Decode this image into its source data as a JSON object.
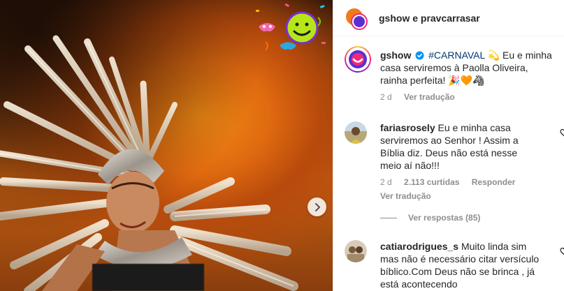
{
  "media": {
    "next_icon": "chevron-right-icon",
    "sticker_icon": "smiley-carnival-sticker"
  },
  "header": {
    "title": "gshow e pravcarrasar",
    "avatar_icon": "gshow-avatar"
  },
  "caption": {
    "username": "gshow",
    "verified_icon": "verified-badge-icon",
    "hashtag": "#CARNAVAL",
    "emoji_1": "💫",
    "text": "Eu e minha casa serviremos à Paolla Oliveira, rainha perfeita!",
    "emoji_2": "🎉🧡🦓",
    "time": "2 d",
    "translate": "Ver tradução"
  },
  "comments": [
    {
      "username": "fariasrosely",
      "text": "Eu e minha casa serviremos ao Senhor ! Assim a Bíblia diz. Deus não está nesse meio aí não!!!",
      "time": "2 d",
      "likes": "2.113 curtidas",
      "reply": "Responder",
      "translate": "Ver tradução",
      "view_replies": "Ver respostas (85)"
    },
    {
      "username": "catiarodrigues_s",
      "text": "Muito linda sim mas não é necessário citar versículo bíblico.Com Deus não se brinca , já está acontecendo"
    }
  ],
  "colors": {
    "link": "#00376b",
    "muted": "#8e8e8e",
    "text": "#262626",
    "verified": "#0095f6"
  }
}
